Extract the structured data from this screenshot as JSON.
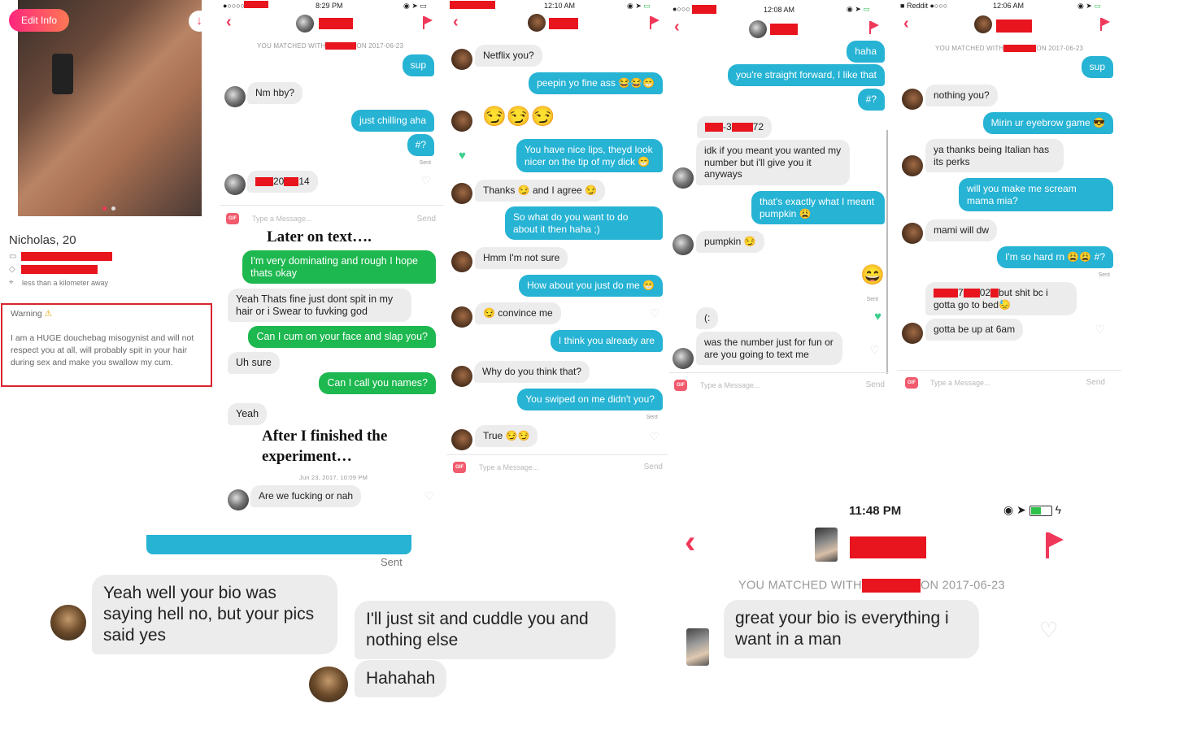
{
  "profile": {
    "edit_info": "Edit Info",
    "name": "Nicholas, 20",
    "distance": "less than a kilometer away",
    "warning_title": "Warning",
    "warning_body": "I am a HUGE douchebag misogynist and will not respect you at all, will probably spit in your hair during sex and make you swallow my cum."
  },
  "chat1": {
    "status_time": "8:29 PM",
    "matched_prefix": "YOU MATCHED WITH",
    "matched_suffix": "ON 2017-06-23",
    "m1": "sup",
    "m2": "Nm hby?",
    "m3": "just chilling aha",
    "m4": "#?",
    "sent": "Sent",
    "m5a": "20",
    "m5b": "14",
    "gif": "GIF",
    "placeholder": "Type a Message...",
    "send": "Send",
    "caption1": "Later on text….",
    "t1": "I'm very dominating and rough I hope thats okay",
    "t2": "Yeah Thats fine just dont spit in my hair or i Swear to fuvking god",
    "t3": "Can I cum on your face and slap you?",
    "t4": "Uh sure",
    "t5": "Can I call you names?",
    "t6": "Yeah",
    "caption2": "After I finished the experiment…",
    "timestamp": "Jun 23, 2017, 10:09 PM",
    "m6": "Are we fucking or nah"
  },
  "chat2": {
    "status_time": "12:10 AM",
    "m1": "Netflix you?",
    "m2": "peepin yo fine ass 😂😂😁",
    "m3": "😏😏😏",
    "m4": "You have nice lips, theyd look nicer on the tip of my dick 😁",
    "m5a": "Thanks 😏 and I agree 😏",
    "m6": "So what do you want to do about it then haha ;)",
    "m7": "Hmm I'm not sure",
    "m8": "How about you just do me 😁",
    "m9": "😏 convince me",
    "m10": "I think you already are",
    "m11": "Why do you think that?",
    "m12": "You swiped on me didn't you?",
    "sent": "Sent",
    "m13": "True 😏😏",
    "gif": "GIF",
    "placeholder": "Type a Message...",
    "send": "Send"
  },
  "chat3": {
    "status_time": "12:08 AM",
    "m1": "haha",
    "m2": "you're straight forward, I like that",
    "m3": "#?",
    "m4a": "-3",
    "m4b": "72",
    "m5": "idk if you meant you wanted my number but i'll give you it anyways",
    "m6": "that's exactly what I meant pumpkin 😩",
    "m7": "pumpkin 😏",
    "m8": "😄",
    "sent": "Sent",
    "m9": "(:",
    "m10": "was the number just for fun or are you going to text me",
    "gif": "GIF",
    "placeholder": "Type a Message...",
    "send": "Send"
  },
  "chat4": {
    "carrier": "Reddit",
    "status_time": "12:06 AM",
    "matched_prefix": "YOU MATCHED WITH",
    "matched_suffix": "ON 2017-06-23",
    "m1": "sup",
    "m2": "nothing you?",
    "m3": "Mirin ur eyebrow game 😎",
    "m4": "ya thanks being Italian has its perks",
    "m5": "will you make me scream mama mia?",
    "m6": "mami will dw",
    "m7": "I'm so hard rn 😩😩 #?",
    "sent": "Sent",
    "m8a": "7",
    "m8b": "02",
    "m8c": "but shit bc i gotta go to bed😓",
    "m9": "gotta be up at 6am",
    "gif": "GIF",
    "placeholder": "Type a Message...",
    "send": "Send"
  },
  "bottom_left": {
    "sent": "Sent",
    "b1": "Yeah well your bio was saying hell no, but your pics said yes",
    "b2": "I'll just sit and cuddle you and nothing else",
    "b3": "Hahahah"
  },
  "bottom_right": {
    "status_time": "11:48 PM",
    "matched_prefix": "YOU MATCHED WITH",
    "matched_suffix": "ON 2017-06-23",
    "b1": "great your bio is everything i want in a man"
  },
  "colors": {
    "tinder_red": "#f0385a",
    "blue_bubble": "#26b3d4",
    "green_bubble": "#1db84f",
    "redaction": "#e8141e",
    "warning_border": "#d9242e"
  }
}
